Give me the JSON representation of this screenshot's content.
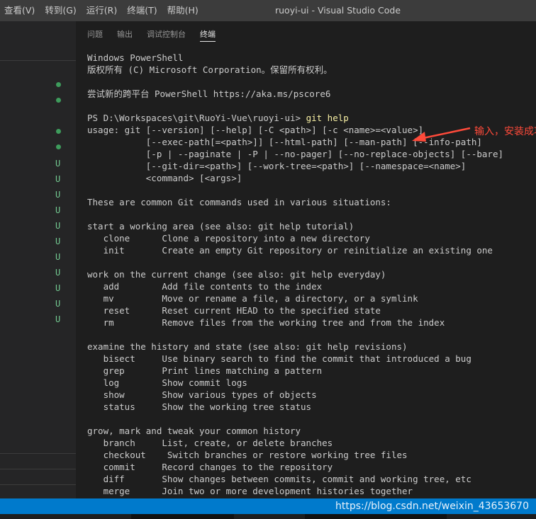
{
  "titlebar": {
    "menu": [
      "查看(V)",
      "转到(G)",
      "运行(R)",
      "终端(T)",
      "帮助(H)"
    ],
    "title": "ruoyi-ui - Visual Studio Code"
  },
  "explorer": {
    "git_status": [
      "U",
      "U",
      "U",
      "U",
      "U",
      "U",
      "U",
      "U",
      "U",
      "U",
      "U"
    ]
  },
  "panel": {
    "tabs": [
      "问题",
      "输出",
      "调试控制台",
      "终端"
    ],
    "active_tab": "终端"
  },
  "terminal": {
    "prompt": "PS D:\\Workspaces\\git\\RuoYi-Vue\\ruoyi-ui> ",
    "command": "git help",
    "lines": [
      "Windows PowerShell",
      "版权所有 (C) Microsoft Corporation。保留所有权利。",
      "",
      "尝试新的跨平台 PowerShell https://aka.ms/pscore6",
      "",
      "__PROMPT__",
      "usage: git [--version] [--help] [-C <path>] [-c <name>=<value>]",
      "           [--exec-path[=<path>]] [--html-path] [--man-path] [--info-path]",
      "           [-p | --paginate | -P | --no-pager] [--no-replace-objects] [--bare]",
      "           [--git-dir=<path>] [--work-tree=<path>] [--namespace=<name>]",
      "           <command> [<args>]",
      "",
      "These are common Git commands used in various situations:",
      "",
      "start a working area (see also: git help tutorial)",
      "   clone      Clone a repository into a new directory",
      "   init       Create an empty Git repository or reinitialize an existing one",
      "",
      "work on the current change (see also: git help everyday)",
      "   add        Add file contents to the index",
      "   mv         Move or rename a file, a directory, or a symlink",
      "   reset      Reset current HEAD to the specified state",
      "   rm         Remove files from the working tree and from the index",
      "",
      "examine the history and state (see also: git help revisions)",
      "   bisect     Use binary search to find the commit that introduced a bug",
      "   grep       Print lines matching a pattern",
      "   log        Show commit logs",
      "   show       Show various types of objects",
      "   status     Show the working tree status",
      "",
      "grow, mark and tweak your common history",
      "   branch     List, create, or delete branches",
      "   checkout    Switch branches or restore working tree files",
      "   commit     Record changes to the repository",
      "   diff       Show changes between commits, commit and working tree, etc",
      "   merge      Join two or more development histories together"
    ]
  },
  "annotation": {
    "text": "输入，安装成功",
    "color": "#ff4a3a"
  },
  "watermark": "https://blog.csdn.net/weixin_43653670",
  "colors": {
    "statusbar": "#007acc",
    "command": "#f9f1a5",
    "git_untracked": "#73c991"
  }
}
